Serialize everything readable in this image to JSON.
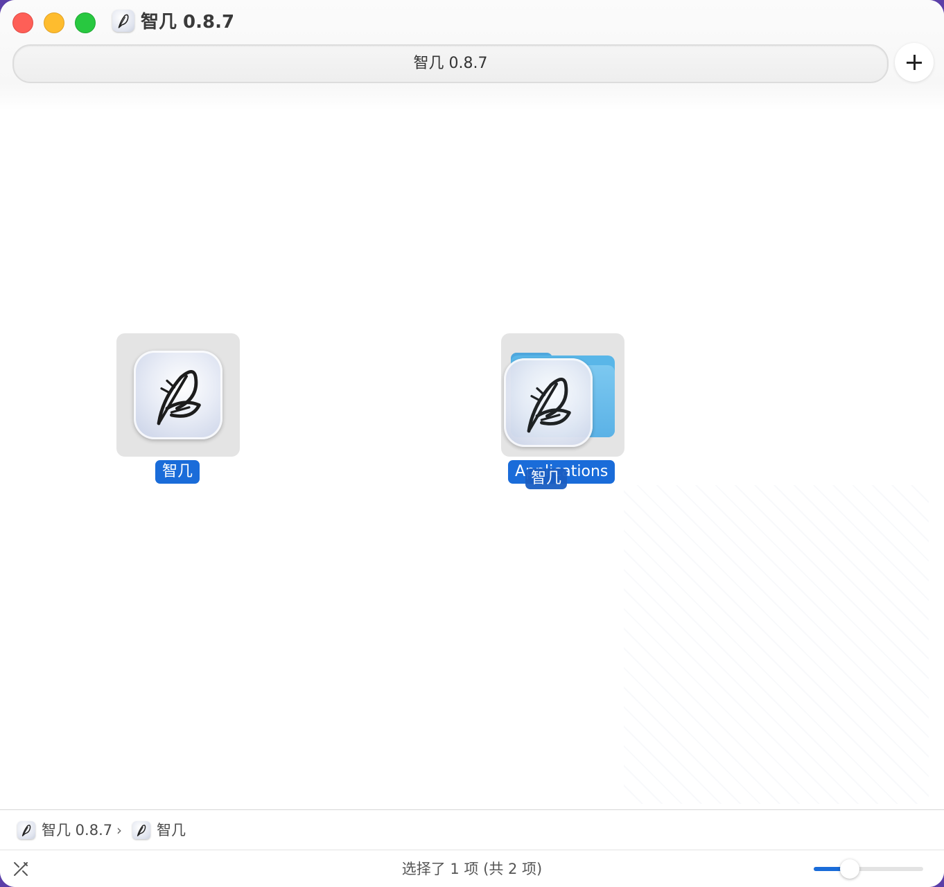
{
  "window": {
    "title": "智几 0.8.7",
    "path": "智几 0.8.7"
  },
  "toolbar": {
    "add_icon": "plus-icon"
  },
  "items": [
    {
      "name": "智几",
      "icon": "leaf-app-icon",
      "selected": true
    },
    {
      "name": "Applications",
      "icon": "folder-icon",
      "drag_overlay_name": "智几"
    }
  ],
  "breadcrumb": [
    {
      "label": "智几 0.8.7",
      "icon": "leaf-app-icon"
    },
    {
      "label": "智几",
      "icon": "leaf-app-icon"
    }
  ],
  "breadcrumb_separator": "›",
  "status": {
    "text": "选择了 1 项 (共 2 项)",
    "icon_size_level": 0.33
  },
  "colors": {
    "selection": "#1a6cd9",
    "close": "#fe5f57",
    "minimize": "#febc2e",
    "zoom": "#28c840"
  }
}
